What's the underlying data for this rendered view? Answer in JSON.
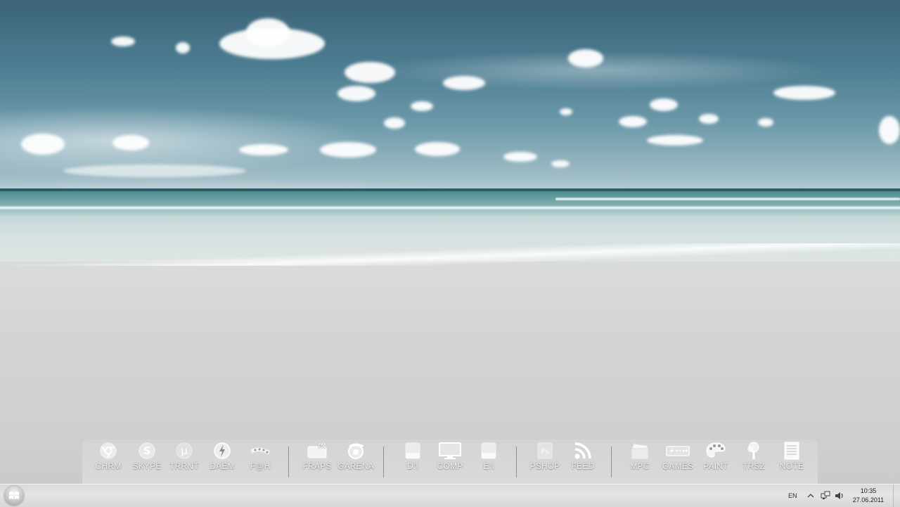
{
  "dock": {
    "groups": [
      [
        {
          "label": "CHRM",
          "icon": "chrome-icon"
        },
        {
          "label": "SKYPE",
          "icon": "skype-icon"
        },
        {
          "label": "TRRNT",
          "icon": "utorrent-icon"
        },
        {
          "label": "DAEM",
          "icon": "daemon-tools-icon"
        },
        {
          "label": "F@H",
          "icon": "folding-at-home-icon"
        }
      ],
      [
        {
          "label": "FRAPS",
          "icon": "fraps-icon"
        },
        {
          "label": "GARENA",
          "icon": "garena-icon"
        }
      ],
      [
        {
          "label": "D:\\",
          "icon": "drive-d-icon"
        },
        {
          "label": "COMP",
          "icon": "computer-monitor-icon"
        },
        {
          "label": "E:\\",
          "icon": "drive-e-icon"
        }
      ],
      [
        {
          "label": "PSHOP",
          "icon": "photoshop-icon"
        },
        {
          "label": "FEED",
          "icon": "rss-feed-icon"
        }
      ],
      [
        {
          "label": "MPC",
          "icon": "media-player-clapper-icon"
        },
        {
          "label": "GAMES",
          "icon": "gamepad-icon"
        },
        {
          "label": "PAINT",
          "icon": "paint-palette-icon"
        },
        {
          "label": "TRSZ",
          "icon": "tree-icon"
        },
        {
          "label": "NOTE",
          "icon": "notepad-icon"
        }
      ]
    ],
    "flat_labels": [
      "CHRM",
      "SKYPE",
      "TRRNT",
      "DAEM",
      "F@H",
      "FRAPS",
      "GARENA",
      "D:\\",
      "COMP",
      "E:\\",
      "PSHOP",
      "FEED",
      "MPC",
      "GAMES",
      "PAINT",
      "TRSZ",
      "NOTE"
    ]
  },
  "taskbar": {
    "start_icon": "windows-logo-icon",
    "language": "EN",
    "tray_icons": [
      "show-hidden-icons-chevron-icon",
      "network-icon",
      "volume-icon"
    ],
    "time": "10:35",
    "date": "27.06.2011"
  }
}
